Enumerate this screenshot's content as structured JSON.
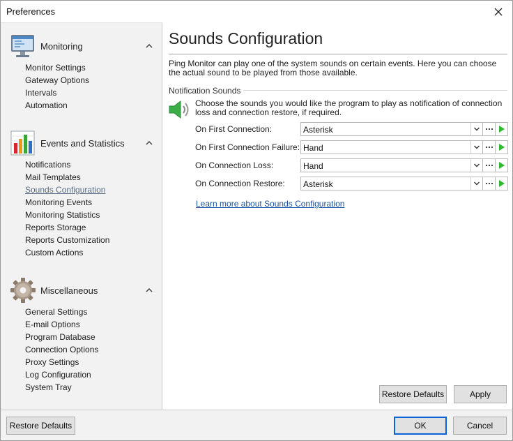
{
  "window": {
    "title": "Preferences"
  },
  "sidebar": {
    "groups": [
      {
        "label": "Monitoring",
        "icon": "monitor-icon",
        "items": [
          "Monitor Settings",
          "Gateway Options",
          "Intervals",
          "Automation"
        ]
      },
      {
        "label": "Events and Statistics",
        "icon": "bar-chart-icon",
        "items": [
          "Notifications",
          "Mail Templates",
          "Sounds Configuration",
          "Monitoring Events",
          "Monitoring Statistics",
          "Reports Storage",
          "Reports Customization",
          "Custom Actions"
        ]
      },
      {
        "label": "Miscellaneous",
        "icon": "gear-icon",
        "items": [
          "General Settings",
          "E-mail Options",
          "Program Database",
          "Connection Options",
          "Proxy Settings",
          "Log Configuration",
          "System Tray"
        ]
      }
    ],
    "selected": "Sounds Configuration"
  },
  "main": {
    "title": "Sounds Configuration",
    "intro": "Ping Monitor can play one of the system sounds on certain events. Here you can choose the actual sound to be played from those available.",
    "section": "Notification Sounds",
    "description": "Choose the sounds you would like the program to play as notification of connection loss and connection restore, if required.",
    "rows": [
      {
        "label": "On First Connection:",
        "value": "Asterisk"
      },
      {
        "label": "On First Connection Failure:",
        "value": "Hand"
      },
      {
        "label": "On Connection Loss:",
        "value": "Hand"
      },
      {
        "label": "On Connection Restore:",
        "value": "Asterisk"
      }
    ],
    "link": "Learn more about Sounds Configuration",
    "restore_defaults": "Restore Defaults",
    "apply": "Apply"
  },
  "footer": {
    "restore_defaults": "Restore Defaults",
    "ok": "OK",
    "cancel": "Cancel"
  },
  "colors": {
    "accent": "#0a64d8",
    "link": "#1a4f9e",
    "play_green": "#2eb82e",
    "selected_item": "#5a6b84"
  }
}
